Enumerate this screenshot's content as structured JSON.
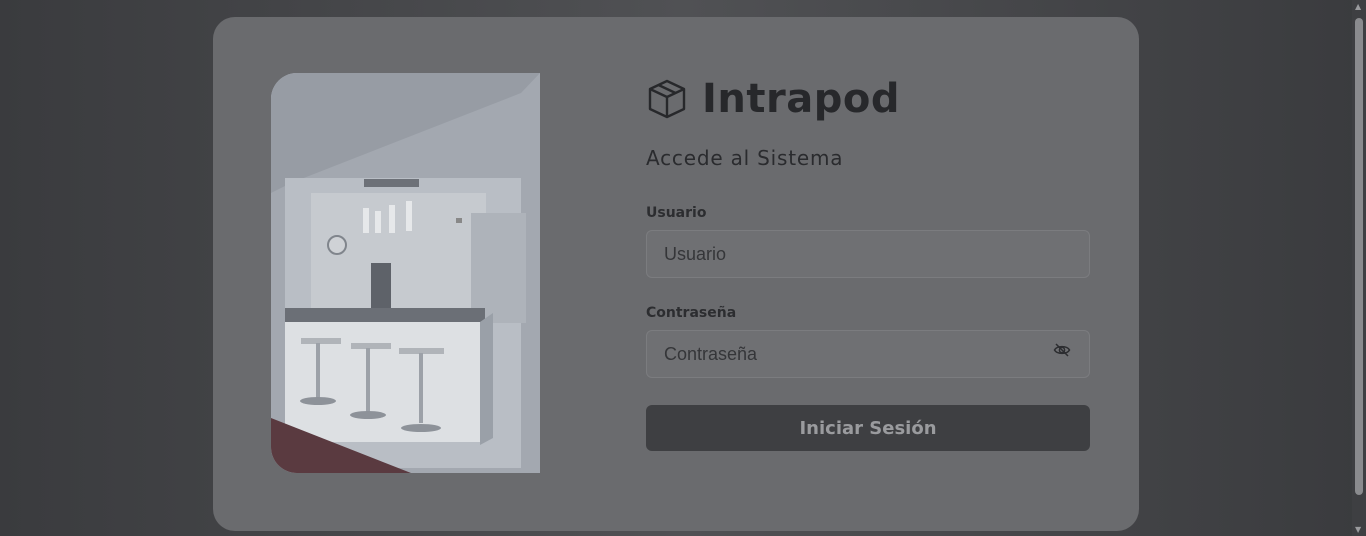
{
  "brand": {
    "name": "Intrapod",
    "logo_icon": "box-icon"
  },
  "login": {
    "subtitle": "Accede al Sistema",
    "username": {
      "label": "Usuario",
      "placeholder": "Usuario",
      "value": ""
    },
    "password": {
      "label": "Contraseña",
      "placeholder": "Contraseña",
      "value": "",
      "toggle_icon": "eye-slash-icon"
    },
    "submit_label": "Iniciar Sesión"
  },
  "image": {
    "subject": "kitchen-photo"
  },
  "colors": {
    "background": "#48494c",
    "card": "#6a6b6e",
    "button": "#3e3f42",
    "text": "#27282b"
  }
}
